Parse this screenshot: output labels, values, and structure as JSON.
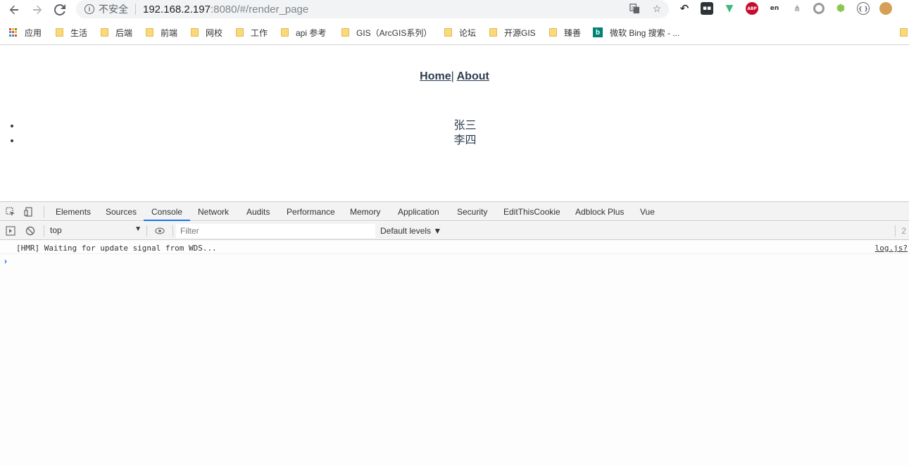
{
  "browser": {
    "security_label": "不安全",
    "url_host": "192.168.2.197",
    "url_rest": ":8080/#/render_page"
  },
  "bookmarks": [
    {
      "label": "应用",
      "icon": "apps-grid-icon"
    },
    {
      "label": "生活",
      "icon": "folder-icon"
    },
    {
      "label": "后端",
      "icon": "folder-icon"
    },
    {
      "label": "前端",
      "icon": "folder-icon"
    },
    {
      "label": "网校",
      "icon": "folder-icon"
    },
    {
      "label": "工作",
      "icon": "folder-icon"
    },
    {
      "label": "api 参考",
      "icon": "folder-icon"
    },
    {
      "label": "GIS（ArcGIS系列）",
      "icon": "folder-icon"
    },
    {
      "label": "论坛",
      "icon": "folder-icon"
    },
    {
      "label": "开源GIS",
      "icon": "folder-icon"
    },
    {
      "label": "臻善",
      "icon": "folder-icon"
    },
    {
      "label": "微软 Bing 搜索 - ...",
      "icon": "bing-icon"
    }
  ],
  "page": {
    "nav": {
      "home": "Home",
      "separator": "|",
      "about": "About"
    },
    "users": [
      "张三",
      "李四"
    ]
  },
  "devtools": {
    "tabs": [
      "Elements",
      "Sources",
      "Console",
      "Network",
      "Audits",
      "Performance",
      "Memory",
      "Application",
      "Security",
      "EditThisCookie",
      "Adblock Plus",
      "Vue"
    ],
    "active_tab": "Console",
    "context": "top",
    "filter_placeholder": "Filter",
    "levels": "Default levels ▼",
    "right_count": "2",
    "messages": [
      {
        "text": "[HMR] Waiting for update signal from WDS...",
        "source": "log.js?"
      }
    ],
    "prompt": "›"
  },
  "colors": {
    "accent": "#1a73e8",
    "page_text": "#2c3e50"
  }
}
